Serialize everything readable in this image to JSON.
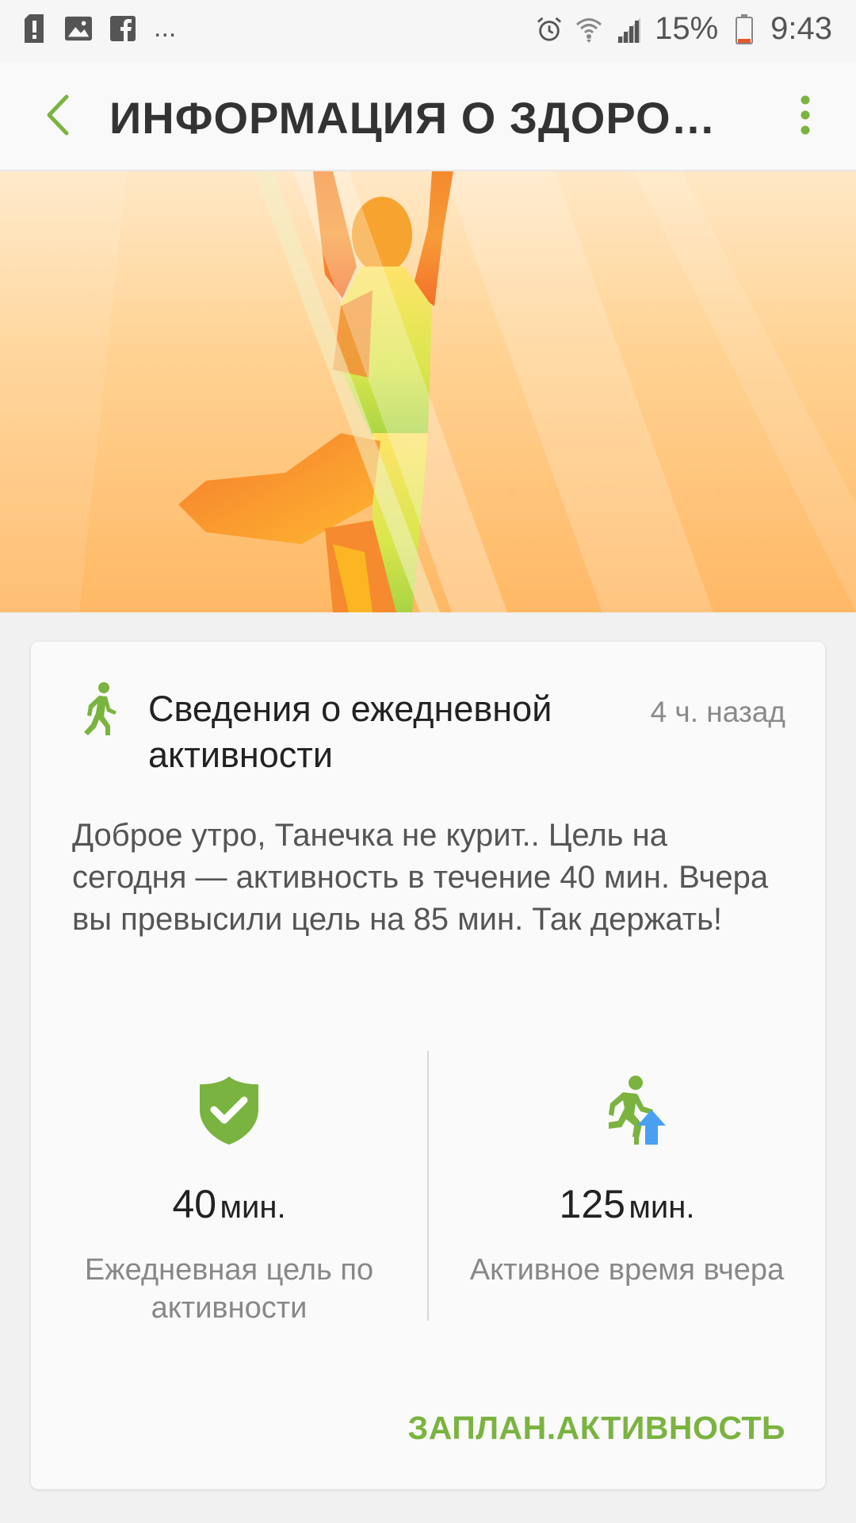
{
  "status_bar": {
    "battery": "15%",
    "time": "9:43",
    "notification_more": "...",
    "icons": [
      "alert-icon",
      "gallery-icon",
      "facebook-icon",
      "alarm-icon",
      "wifi-icon",
      "signal-icon",
      "battery-icon"
    ]
  },
  "app_bar": {
    "title": "ИНФОРМАЦИЯ О ЗДОРОВ…",
    "back_icon": "back-arrow-icon",
    "menu_icon": "more-vert-icon"
  },
  "card": {
    "icon": "walking-person-icon",
    "title": "Сведения о ежедневной активности",
    "time": "4 ч. назад",
    "message": "Доброе утро, Танечка не курит.. Цель на сегодня — активность в течение 40 мин. Вчера вы превысили цель на 85 мин. Так держать!",
    "stats": [
      {
        "icon": "shield-check-icon",
        "value": "40",
        "unit": "мин.",
        "label": "Ежедневная цель по активности"
      },
      {
        "icon": "running-up-icon",
        "value": "125",
        "unit": "мин.",
        "label": "Активное время вчера"
      }
    ],
    "action": "ЗАПЛАН.АКТИВНОСТЬ"
  },
  "colors": {
    "accent_green": "#7bb340",
    "banner_orange": "#ffb865",
    "up_arrow_blue": "#4a9ff0"
  }
}
